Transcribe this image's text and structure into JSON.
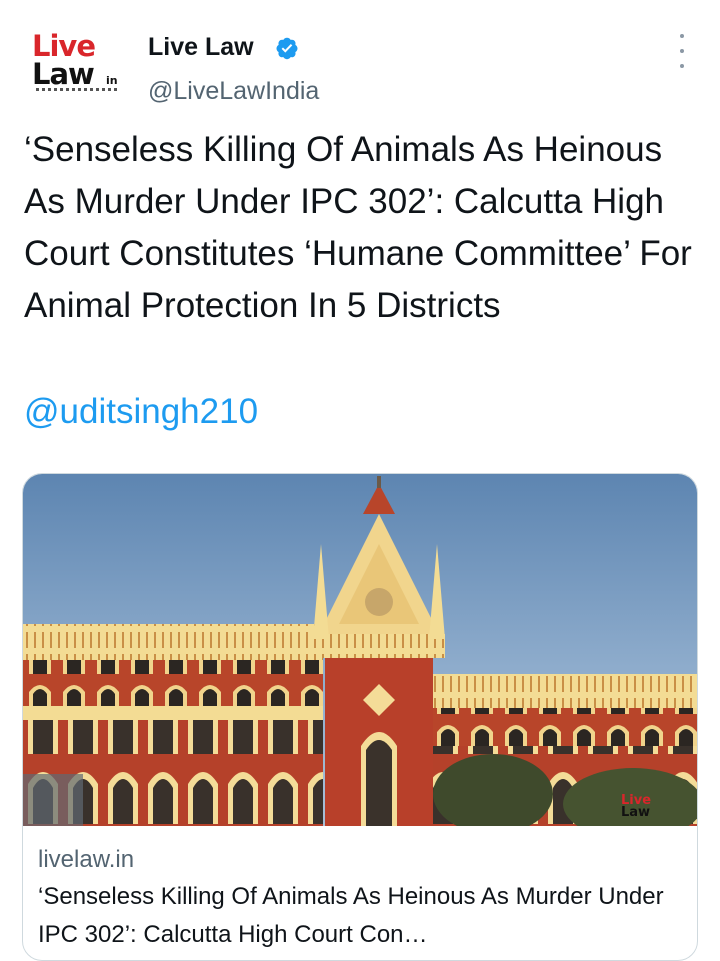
{
  "author": {
    "name": "Live Law",
    "handle": "@LiveLawIndia",
    "verified": true,
    "avatar_logo": {
      "line1": "Live",
      "line2": "Law",
      "suffix": "in"
    }
  },
  "tweet": {
    "text": "‘Senseless Killing Of Animals As Heinous As Murder Under IPC 302’: Calcutta High Court Constitutes ‘Humane Committee’ For Animal Protection In 5 Districts",
    "mention": "@uditsingh210"
  },
  "link_card": {
    "domain": "livelaw.in",
    "title": "‘Senseless Killing Of Animals As Heinous As Murder Under IPC 302’: Calcutta High Court Con…",
    "image_watermark": {
      "line1": "Live",
      "line2": "Law"
    }
  },
  "colors": {
    "link": "#1d9bf0",
    "verified": "#1d9bf0",
    "secondary_text": "#536471",
    "brand_red": "#d9262b"
  },
  "icons": {
    "verified": "verified-badge-icon",
    "more": "more-options-icon"
  }
}
